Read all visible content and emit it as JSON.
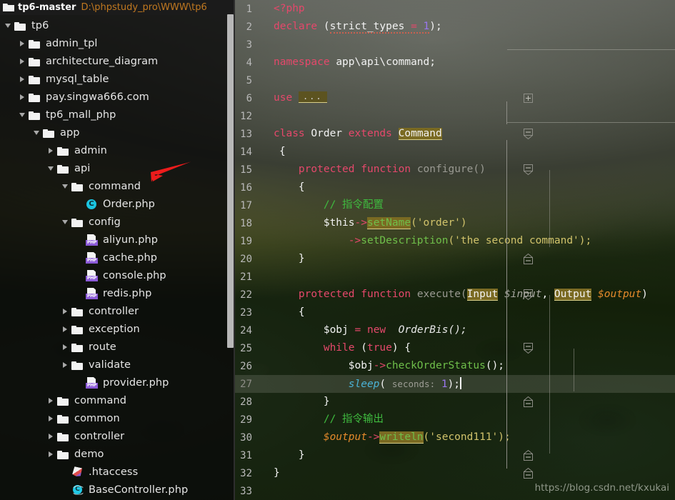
{
  "titlebar": {
    "project_name": "tp6-master",
    "project_path": "D:\\phpstudy_pro\\WWW\\tp6",
    "folder_icon": "folder-icon"
  },
  "sidebar": {
    "scrollbar": "vertical-scrollbar",
    "annotation_icon": "red-arrow-icon",
    "tree": [
      {
        "label": "tp6",
        "indent": 0,
        "twisty": "expanded",
        "icon": "folder-icon"
      },
      {
        "label": "admin_tpl",
        "indent": 1,
        "twisty": "collapsed",
        "icon": "folder-icon"
      },
      {
        "label": "architecture_diagram",
        "indent": 1,
        "twisty": "collapsed",
        "icon": "folder-icon"
      },
      {
        "label": "mysql_table",
        "indent": 1,
        "twisty": "collapsed",
        "icon": "folder-icon"
      },
      {
        "label": "pay.singwa666.com",
        "indent": 1,
        "twisty": "collapsed",
        "icon": "folder-icon"
      },
      {
        "label": "tp6_mall_php",
        "indent": 1,
        "twisty": "expanded",
        "icon": "folder-icon"
      },
      {
        "label": "app",
        "indent": 2,
        "twisty": "expanded",
        "icon": "folder-icon"
      },
      {
        "label": "admin",
        "indent": 3,
        "twisty": "collapsed",
        "icon": "folder-icon"
      },
      {
        "label": "api",
        "indent": 3,
        "twisty": "expanded",
        "icon": "folder-icon"
      },
      {
        "label": "command",
        "indent": 4,
        "twisty": "expanded",
        "icon": "folder-icon"
      },
      {
        "label": "Order.php",
        "indent": 5,
        "twisty": "none",
        "icon": "php-class-icon"
      },
      {
        "label": "config",
        "indent": 4,
        "twisty": "expanded",
        "icon": "folder-icon"
      },
      {
        "label": "aliyun.php",
        "indent": 5,
        "twisty": "none",
        "icon": "php-file-icon"
      },
      {
        "label": "cache.php",
        "indent": 5,
        "twisty": "none",
        "icon": "php-file-icon"
      },
      {
        "label": "console.php",
        "indent": 5,
        "twisty": "none",
        "icon": "php-file-icon"
      },
      {
        "label": "redis.php",
        "indent": 5,
        "twisty": "none",
        "icon": "php-file-icon"
      },
      {
        "label": "controller",
        "indent": 4,
        "twisty": "collapsed",
        "icon": "folder-icon"
      },
      {
        "label": "exception",
        "indent": 4,
        "twisty": "collapsed",
        "icon": "folder-icon"
      },
      {
        "label": "route",
        "indent": 4,
        "twisty": "collapsed",
        "icon": "folder-icon"
      },
      {
        "label": "validate",
        "indent": 4,
        "twisty": "collapsed",
        "icon": "folder-icon"
      },
      {
        "label": "provider.php",
        "indent": 5,
        "twisty": "none",
        "icon": "php-file-icon"
      },
      {
        "label": "command",
        "indent": 3,
        "twisty": "collapsed",
        "icon": "folder-icon"
      },
      {
        "label": "common",
        "indent": 3,
        "twisty": "collapsed",
        "icon": "folder-icon"
      },
      {
        "label": "controller",
        "indent": 3,
        "twisty": "collapsed",
        "icon": "folder-icon"
      },
      {
        "label": "demo",
        "indent": 3,
        "twisty": "collapsed",
        "icon": "folder-icon"
      },
      {
        "label": ".htaccess",
        "indent": 4,
        "twisty": "none",
        "icon": "htaccess-icon"
      },
      {
        "label": "BaseController.php",
        "indent": 4,
        "twisty": "none",
        "icon": "php-abstract-class-icon"
      }
    ]
  },
  "editor": {
    "filename": "Order.php",
    "active_line": 27,
    "line_numbers": [
      1,
      2,
      3,
      4,
      5,
      6,
      12,
      13,
      14,
      15,
      16,
      17,
      18,
      19,
      20,
      21,
      22,
      23,
      24,
      25,
      26,
      27,
      28,
      29,
      30,
      31,
      32,
      33
    ],
    "folded_import_placeholder": "...",
    "code": {
      "l1": "<?php",
      "l2_declare": "declare",
      "l2_strict": "strict_types",
      "l2_eq": "=",
      "l2_one": "1",
      "l4_kw": "namespace",
      "l4_ns": "app\\api\\command;",
      "l6_use": "use",
      "l13_class": "class",
      "l13_name": "Order",
      "l13_extends": "extends",
      "l13_parent": "Command",
      "l14_brace": "{",
      "l15_mod": "protected",
      "l15_fn": "function",
      "l15_name": "configure()",
      "l16_brace": "{",
      "l17_comment": "// 指令配置",
      "l18_this": "$this",
      "l18_arrow": "->",
      "l18_method": "setName",
      "l18_arg": "('order')",
      "l19_arrow": "->",
      "l19_method": "setDescription",
      "l19_arg": "('the second command');",
      "l20_brace": "}",
      "l22_mod": "protected",
      "l22_fn": "function",
      "l22_name": "execute(",
      "l22_t1": "Input",
      "l22_p1": "$input",
      "l22_comma": ", ",
      "l22_t2": "Output",
      "l22_p2": "$output",
      "l22_close": ")",
      "l23_brace": "{",
      "l24_var": "$obj",
      "l24_eq": "=",
      "l24_new": "new",
      "l24_cls": "OrderBis();",
      "l25_while": "while",
      "l25_cond": "(",
      "l25_true": "true",
      "l25_rest": ") {",
      "l26_var": "$obj",
      "l26_arrow": "->",
      "l26_method": "checkOrderStatus",
      "l26_args": "();",
      "l27_fn": "sleep",
      "l27_open": "(",
      "l27_hint": "seconds:",
      "l27_val": "1",
      "l27_close": ");",
      "l28_brace": "}",
      "l29_comment": "// 指令输出",
      "l30_var": "$output",
      "l30_arrow": "->",
      "l30_method": "writeln",
      "l30_arg": "('second111');",
      "l31_brace": "}",
      "l32_brace": "}"
    }
  },
  "watermark": "https://blog.csdn.net/kxukai",
  "colors": {
    "keyword": "#e5486b",
    "string": "#d1c36b",
    "comment": "#3fbb3f",
    "number": "#9a77ef",
    "method_green": "#6fbf4a",
    "highlight": "#7a6a22",
    "path_orange": "#c07820",
    "php_purple": "#8c5bd8",
    "class_cyan": "#1bc4e0",
    "arrow_red": "#ee1c1c"
  }
}
